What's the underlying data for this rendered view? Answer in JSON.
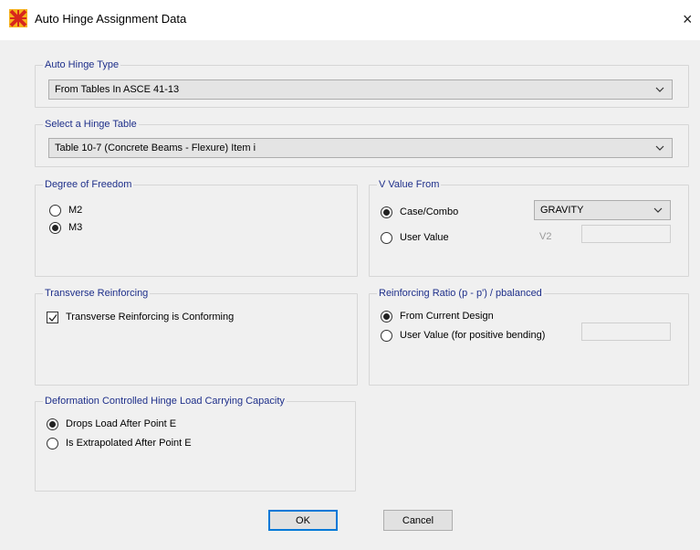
{
  "window": {
    "title": "Auto Hinge Assignment Data",
    "close_glyph": "×"
  },
  "auto_hinge_type": {
    "label": "Auto Hinge Type",
    "value": "From Tables In ASCE 41-13"
  },
  "hinge_table": {
    "label": "Select a Hinge Table",
    "value": "Table 10-7 (Concrete Beams - Flexure) Item i"
  },
  "dof": {
    "label": "Degree of Freedom",
    "options": [
      {
        "label": "M2",
        "selected": false
      },
      {
        "label": "M3",
        "selected": true
      }
    ]
  },
  "v_value": {
    "label": "V Value From",
    "case_combo": {
      "label": "Case/Combo",
      "selected": true
    },
    "combo_select": "GRAVITY",
    "user_value": {
      "label": "User Value",
      "selected": false
    },
    "v2_label": "V2",
    "v2_value": ""
  },
  "transverse": {
    "label": "Transverse Reinforcing",
    "checkbox_label": "Transverse Reinforcing is Conforming",
    "checked": true
  },
  "reinforcing_ratio": {
    "label": "Reinforcing Ratio  (p - p') / pbalanced",
    "from_design": {
      "label": "From Current Design",
      "selected": true
    },
    "user_value": {
      "label": "User Value (for positive bending)",
      "selected": false
    },
    "user_value_input": ""
  },
  "deformation": {
    "label": "Deformation Controlled Hinge Load Carrying Capacity",
    "options": [
      {
        "label": "Drops Load After Point E",
        "selected": true
      },
      {
        "label": "Is Extrapolated After Point E",
        "selected": false
      }
    ]
  },
  "buttons": {
    "ok": "OK",
    "cancel": "Cancel"
  }
}
